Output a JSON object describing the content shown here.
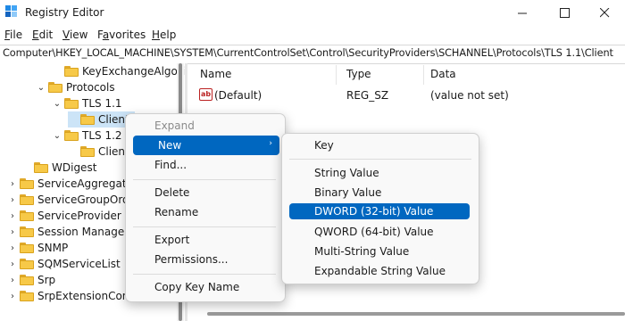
{
  "window": {
    "title": "Registry Editor",
    "controls": [
      "minimize",
      "maximize",
      "close"
    ]
  },
  "menubar": [
    {
      "key": "F",
      "rest": "ile"
    },
    {
      "key": "E",
      "rest": "dit"
    },
    {
      "key": "V",
      "rest": "iew"
    },
    {
      "key": "F",
      "rest": "avorites",
      "pre": ""
    },
    {
      "key": "H",
      "rest": "elp"
    }
  ],
  "menubar_labels": [
    "File",
    "Edit",
    "View",
    "Favorites",
    "Help"
  ],
  "address": "Computer\\HKEY_LOCAL_MACHINE\\SYSTEM\\CurrentControlSet\\Control\\SecurityProviders\\SCHANNEL\\Protocols\\TLS 1.1\\Client",
  "tree": [
    {
      "label": "KeyExchangeAlgorithm",
      "indent": 3,
      "chev": ""
    },
    {
      "label": "Protocols",
      "indent": 2,
      "chev": "⌄"
    },
    {
      "label": "TLS 1.1",
      "indent": 3,
      "chev": "⌄"
    },
    {
      "label": "Client",
      "indent": 4,
      "chev": "",
      "selected": true
    },
    {
      "label": "TLS 1.2",
      "indent": 3,
      "chev": "⌄"
    },
    {
      "label": "Client",
      "indent": 4,
      "chev": ""
    },
    {
      "label": "WDigest",
      "indent": 1,
      "chev": ""
    },
    {
      "label": "ServiceAggregatedEvents",
      "indent": 0,
      "chev": "›"
    },
    {
      "label": "ServiceGroupOrder",
      "indent": 0,
      "chev": "›"
    },
    {
      "label": "ServiceProvider",
      "indent": 0,
      "chev": "›"
    },
    {
      "label": "Session Manager",
      "indent": 0,
      "chev": "›"
    },
    {
      "label": "SNMP",
      "indent": 0,
      "chev": "›"
    },
    {
      "label": "SQMServiceList",
      "indent": 0,
      "chev": "›"
    },
    {
      "label": "Srp",
      "indent": 0,
      "chev": "›"
    },
    {
      "label": "SrpExtensionConfig",
      "indent": 0,
      "chev": "›"
    }
  ],
  "columns": {
    "name": "Name",
    "type": "Type",
    "data": "Data"
  },
  "values": [
    {
      "name": "(Default)",
      "type": "REG_SZ",
      "data": "(value not set)",
      "icon": "ab"
    }
  ],
  "context_menu": {
    "items": [
      {
        "label": "Expand",
        "disabled": true
      },
      {
        "label": "New",
        "submenu": true,
        "highlighted": true
      },
      {
        "label": "Find..."
      },
      {
        "label": "Delete"
      },
      {
        "label": "Rename"
      },
      {
        "label": "Export"
      },
      {
        "label": "Permissions..."
      },
      {
        "label": "Copy Key Name"
      }
    ]
  },
  "submenu": {
    "items": [
      {
        "label": "Key"
      },
      {
        "label": "String Value"
      },
      {
        "label": "Binary Value"
      },
      {
        "label": "DWORD (32-bit) Value",
        "highlighted": true
      },
      {
        "label": "QWORD (64-bit) Value"
      },
      {
        "label": "Multi-String Value"
      },
      {
        "label": "Expandable String Value"
      }
    ]
  },
  "colors": {
    "highlight": "#0067c0",
    "tree_selected": "#cce4f7",
    "folder": "#f7c948"
  }
}
